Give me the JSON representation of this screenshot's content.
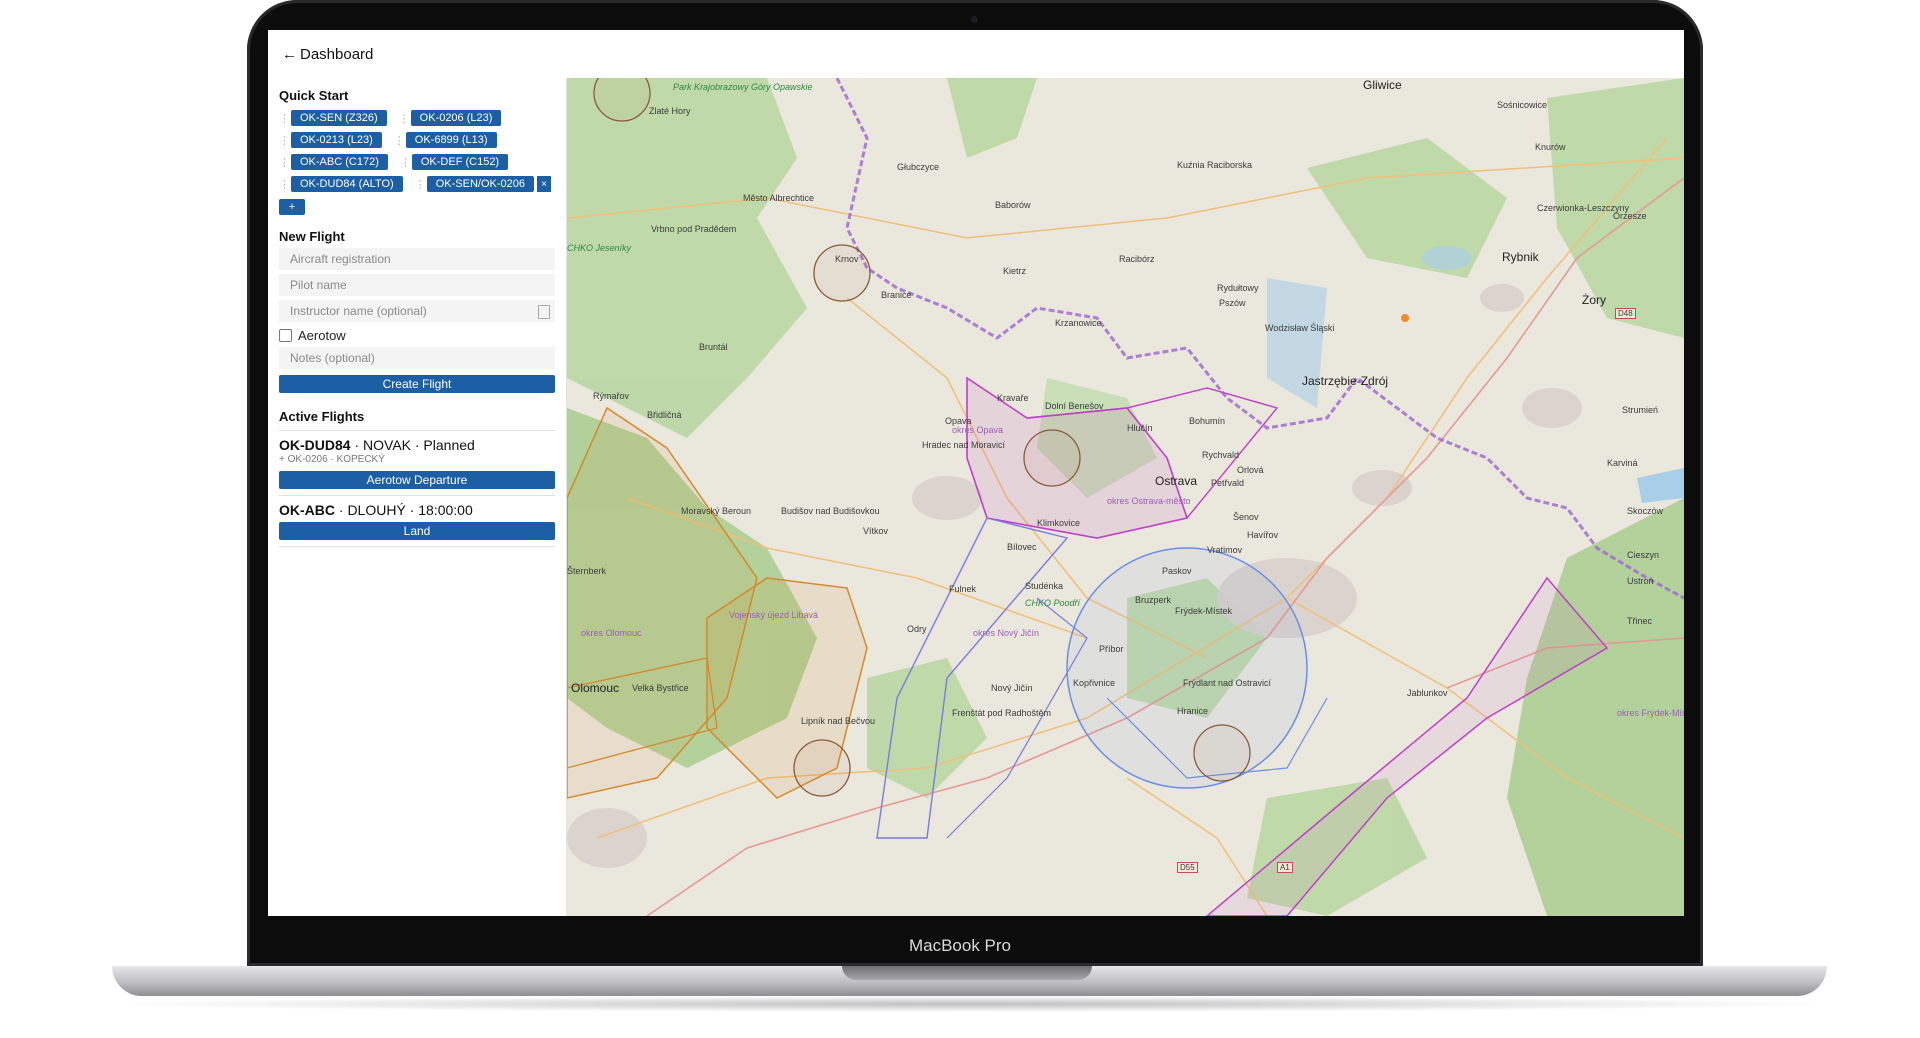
{
  "device": {
    "model": "MacBook Pro"
  },
  "header": {
    "back_label": "Dashboard"
  },
  "quick_start": {
    "title": "Quick Start",
    "rows": [
      [
        "OK-SEN (Z326)",
        "OK-0206 (L23)"
      ],
      [
        "OK-0213 (L23)",
        "OK-6899 (L13)"
      ],
      [
        "OK-ABC (C172)",
        "OK-DEF (C152)"
      ],
      [
        "OK-DUD84 (ALTO)",
        "OK-SEN/OK-0206"
      ]
    ],
    "remove_symbol": "×",
    "add_label": "+"
  },
  "new_flight": {
    "title": "New Flight",
    "aircraft_placeholder": "Aircraft registration",
    "pilot_placeholder": "Pilot name",
    "instructor_placeholder": "Instructor name (optional)",
    "aerotow_label": "Aerotow",
    "notes_placeholder": "Notes (optional)",
    "create_label": "Create Flight"
  },
  "active_flights": {
    "title": "Active Flights",
    "flights": [
      {
        "registration": "OK-DUD84",
        "details": " · NOVAK · Planned",
        "sub": "+ OK-0206 · KOPECKÝ",
        "action": "Aerotow Departure"
      },
      {
        "registration": "OK-ABC",
        "details": " · DLOUHÝ · 18:00:00",
        "sub": "",
        "action": "Land"
      }
    ]
  },
  "map": {
    "places": [
      {
        "name": "Gliwice",
        "kind": "city"
      },
      {
        "name": "Sośnicowice",
        "kind": "town"
      },
      {
        "name": "Knurów",
        "kind": "town"
      },
      {
        "name": "Park Krajobrazowy Góry Opawskie",
        "kind": "green"
      },
      {
        "name": "Zlaté Hory",
        "kind": "town"
      },
      {
        "name": "Głubczyce",
        "kind": "town"
      },
      {
        "name": "Kuźnia Raciborska",
        "kind": "town"
      },
      {
        "name": "Město Albrechtice",
        "kind": "town"
      },
      {
        "name": "Baborów",
        "kind": "town"
      },
      {
        "name": "Czerwionka-Leszczyny",
        "kind": "town"
      },
      {
        "name": "Orzesze",
        "kind": "town"
      },
      {
        "name": "Vrbno pod Pradědem",
        "kind": "town"
      },
      {
        "name": "CHKO Jeseníky",
        "kind": "green"
      },
      {
        "name": "Krnov",
        "kind": "town"
      },
      {
        "name": "Racibórz",
        "kind": "town"
      },
      {
        "name": "Rybnik",
        "kind": "city"
      },
      {
        "name": "Kietrz",
        "kind": "town"
      },
      {
        "name": "Branice",
        "kind": "town"
      },
      {
        "name": "Rydułtowy",
        "kind": "town"
      },
      {
        "name": "Żory",
        "kind": "city"
      },
      {
        "name": "Pszów",
        "kind": "town"
      },
      {
        "name": "Krzanowice",
        "kind": "town"
      },
      {
        "name": "Wodzisław Śląski",
        "kind": "town"
      },
      {
        "name": "Bruntál",
        "kind": "town"
      },
      {
        "name": "Jastrzębie-Zdrój",
        "kind": "city"
      },
      {
        "name": "Rýmařov",
        "kind": "town"
      },
      {
        "name": "Opava",
        "kind": "town"
      },
      {
        "name": "Kravaře",
        "kind": "town"
      },
      {
        "name": "Dolní Benešov",
        "kind": "town"
      },
      {
        "name": "Bohumín",
        "kind": "town"
      },
      {
        "name": "Strumień",
        "kind": "town"
      },
      {
        "name": "Břidličná",
        "kind": "town"
      },
      {
        "name": "okres Opava",
        "kind": "purple"
      },
      {
        "name": "Hlučín",
        "kind": "town"
      },
      {
        "name": "Hradec nad Moravicí",
        "kind": "town"
      },
      {
        "name": "Rychvald",
        "kind": "town"
      },
      {
        "name": "Karviná",
        "kind": "town"
      },
      {
        "name": "Orlová",
        "kind": "town"
      },
      {
        "name": "Ostrava",
        "kind": "city"
      },
      {
        "name": "Petřvald",
        "kind": "town"
      },
      {
        "name": "okres Ostrava-město",
        "kind": "purple"
      },
      {
        "name": "Moravský Beroun",
        "kind": "town"
      },
      {
        "name": "Budišov nad Budišovkou",
        "kind": "town"
      },
      {
        "name": "Šenov",
        "kind": "town"
      },
      {
        "name": "Skoczów",
        "kind": "town"
      },
      {
        "name": "Klimkovice",
        "kind": "town"
      },
      {
        "name": "Vítkov",
        "kind": "town"
      },
      {
        "name": "Havířov",
        "kind": "town"
      },
      {
        "name": "Vratimov",
        "kind": "town"
      },
      {
        "name": "Šternberk",
        "kind": "town"
      },
      {
        "name": "Bílovec",
        "kind": "town"
      },
      {
        "name": "Cieszyn",
        "kind": "town"
      },
      {
        "name": "Studénka",
        "kind": "town"
      },
      {
        "name": "CHKO Poodří",
        "kind": "green"
      },
      {
        "name": "Paskov",
        "kind": "town"
      },
      {
        "name": "Ustroń",
        "kind": "town"
      },
      {
        "name": "Fulnek",
        "kind": "town"
      },
      {
        "name": "Bruzperk",
        "kind": "town"
      },
      {
        "name": "Vojenský újezd Libavá",
        "kind": "purple"
      },
      {
        "name": "Odry",
        "kind": "town"
      },
      {
        "name": "Frýdek-Místek",
        "kind": "town"
      },
      {
        "name": "okres Olomouc",
        "kind": "purple"
      },
      {
        "name": "Třinec",
        "kind": "town"
      },
      {
        "name": "okres Nový Jičín",
        "kind": "purple"
      },
      {
        "name": "Příbor",
        "kind": "town"
      },
      {
        "name": "Olomouc",
        "kind": "city"
      },
      {
        "name": "Velká Bystřice",
        "kind": "town"
      },
      {
        "name": "Kopřivnice",
        "kind": "town"
      },
      {
        "name": "Nový Jičín",
        "kind": "town"
      },
      {
        "name": "Frýdlant nad Ostravicí",
        "kind": "town"
      },
      {
        "name": "Jablunkov",
        "kind": "town"
      },
      {
        "name": "okres Frýdek-Místek",
        "kind": "purple"
      },
      {
        "name": "Hranice",
        "kind": "town"
      },
      {
        "name": "Frenštát pod Radhoštěm",
        "kind": "town"
      },
      {
        "name": "Lipník nad Bečvou",
        "kind": "town"
      },
      {
        "name": "D48",
        "kind": "road"
      },
      {
        "name": "D55",
        "kind": "road"
      },
      {
        "name": "A1",
        "kind": "road"
      }
    ]
  }
}
